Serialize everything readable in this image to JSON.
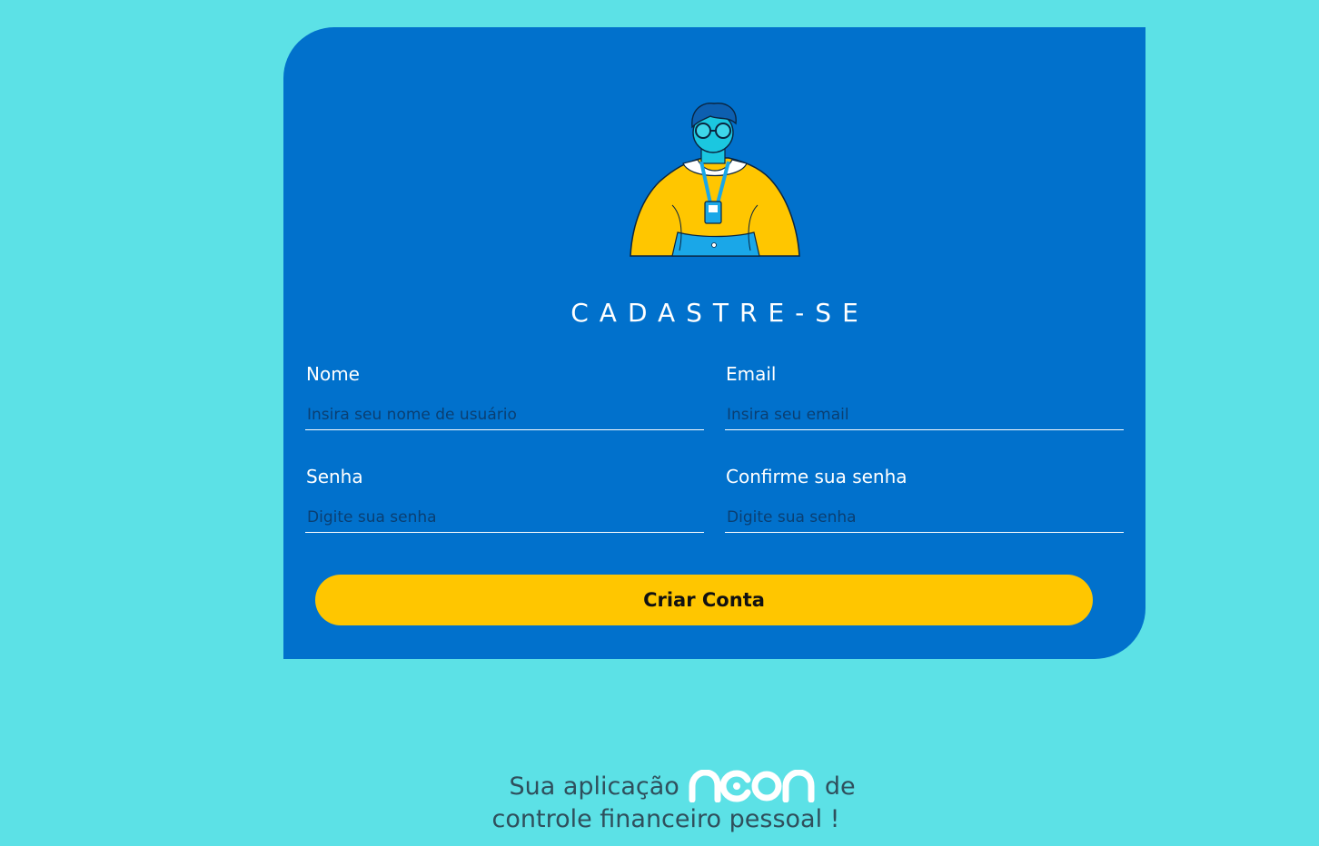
{
  "page": {
    "title": "CADASTRE-SE"
  },
  "form": {
    "name": {
      "label": "Nome",
      "placeholder": "Insira seu nome de usuário",
      "value": ""
    },
    "email": {
      "label": "Email",
      "placeholder": "Insira seu email",
      "value": ""
    },
    "password": {
      "label": "Senha",
      "placeholder": "Digite sua senha",
      "value": ""
    },
    "confirm_password": {
      "label": "Confirme sua senha",
      "placeholder": "Digite sua senha",
      "value": ""
    },
    "submit_label": "Criar Conta"
  },
  "footer": {
    "prefix": "Sua aplicação",
    "brand": "neon",
    "suffix": "de",
    "line2": "controle financeiro pessoal !"
  },
  "colors": {
    "background": "#5ce1e6",
    "card": "#0171cc",
    "button": "#ffc600",
    "text_light": "#ffffff"
  },
  "icons": {
    "illustration": "person-with-badge-illustration",
    "logo": "neon-logo"
  }
}
